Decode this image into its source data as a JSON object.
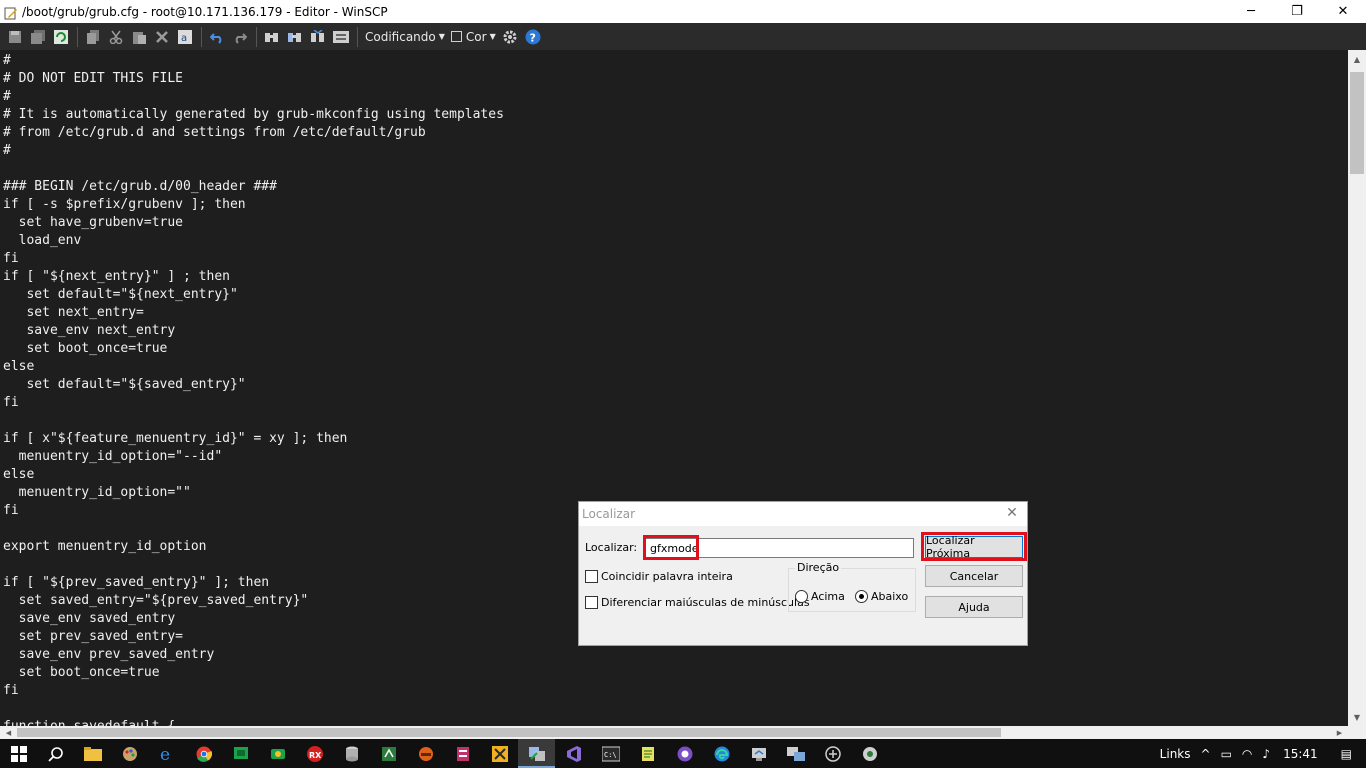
{
  "window": {
    "title": "/boot/grub/grub.cfg - root@10.171.136.179 - Editor - WinSCP",
    "minimize": "─",
    "restore": "❐",
    "close": "✕"
  },
  "toolbar": {
    "encoding_label": "Codificando",
    "color_label": "Cor",
    "icons": [
      "save-icon",
      "save-all-icon",
      "reload-icon",
      "copy-icon",
      "cut-icon",
      "paste-icon",
      "delete-icon",
      "select-all-icon",
      "undo-icon",
      "redo-icon",
      "find-icon",
      "replace-icon",
      "find-next-icon",
      "goto-line-icon",
      "encoding-menu",
      "color-checkbox",
      "settings-icon",
      "help-icon"
    ]
  },
  "editor": {
    "lines": [
      "#",
      "# DO NOT EDIT THIS FILE",
      "#",
      "# It is automatically generated by grub-mkconfig using templates",
      "# from /etc/grub.d and settings from /etc/default/grub",
      "#",
      "",
      "### BEGIN /etc/grub.d/00_header ###",
      "if [ -s $prefix/grubenv ]; then",
      "  set have_grubenv=true",
      "  load_env",
      "fi",
      "if [ \"${next_entry}\" ] ; then",
      "   set default=\"${next_entry}\"",
      "   set next_entry=",
      "   save_env next_entry",
      "   set boot_once=true",
      "else",
      "   set default=\"${saved_entry}\"",
      "fi",
      "",
      "if [ x\"${feature_menuentry_id}\" = xy ]; then",
      "  menuentry_id_option=\"--id\"",
      "else",
      "  menuentry_id_option=\"\"",
      "fi",
      "",
      "export menuentry_id_option",
      "",
      "if [ \"${prev_saved_entry}\" ]; then",
      "  set saved_entry=\"${prev_saved_entry}\"",
      "  save_env saved_entry",
      "  set prev_saved_entry=",
      "  save_env prev_saved_entry",
      "  set boot_once=true",
      "fi",
      "",
      "function savedefault {"
    ]
  },
  "find_dialog": {
    "title": "Localizar",
    "search_label": "Localizar:",
    "search_value": "gfxmode",
    "find_next_button": "Localizar Próxima",
    "cancel_button": "Cancelar",
    "help_button": "Ajuda",
    "whole_word_label": "Coincidir palavra inteira",
    "whole_word_checked": false,
    "case_label": "Diferenciar maiúsculas de minúsculas",
    "case_checked": false,
    "direction_group": "Direção",
    "direction_up": "Acima",
    "direction_down": "Abaixo",
    "direction_selected": "Abaixo",
    "highlight_color": "#e0101c"
  },
  "taskbar": {
    "tray_links": "Links",
    "clock": "15:41"
  }
}
